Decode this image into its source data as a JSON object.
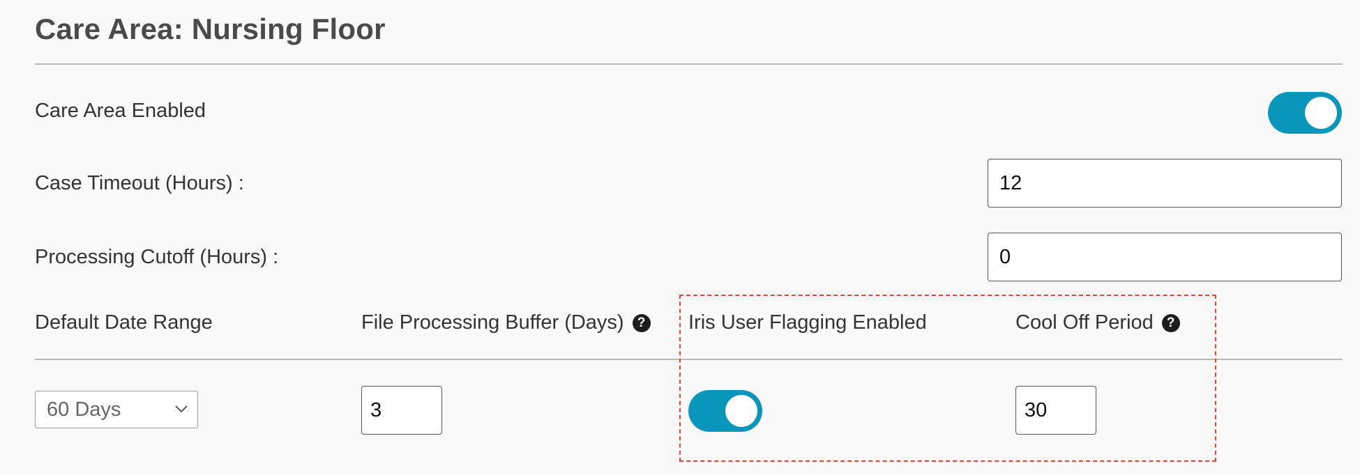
{
  "header": {
    "title": "Care Area: Nursing Floor"
  },
  "settings": {
    "care_area_enabled": {
      "label": "Care Area Enabled",
      "enabled": true
    },
    "case_timeout": {
      "label": "Case Timeout (Hours) :",
      "value": "12"
    },
    "processing_cutoff": {
      "label": "Processing Cutoff (Hours) :",
      "value": "0"
    }
  },
  "columns": {
    "default_date_range": {
      "label": "Default Date Range",
      "selected": "60 Days"
    },
    "file_processing_buffer": {
      "label": "File Processing Buffer (Days)",
      "value": "3",
      "help_icon": "question-circle-icon"
    },
    "iris_user_flagging": {
      "label": "Iris User Flagging Enabled",
      "enabled": true
    },
    "cool_off_period": {
      "label": "Cool Off Period",
      "value": "30",
      "help_icon": "question-circle-icon"
    }
  },
  "colors": {
    "toggle_on": "#0a96bb",
    "highlight_border": "#e0453a"
  },
  "icons": {
    "help_glyph": "?"
  }
}
